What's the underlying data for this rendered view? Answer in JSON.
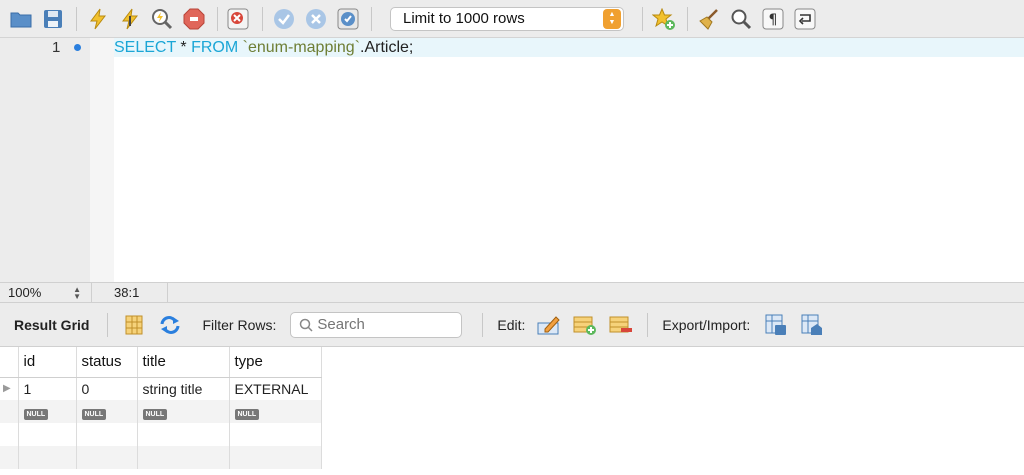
{
  "toolbar": {
    "buttons": [
      {
        "icon": "folder-icon",
        "tooltip": ""
      },
      {
        "icon": "save-icon",
        "tooltip": ""
      },
      {
        "icon": "execute-icon",
        "tooltip": ""
      },
      {
        "icon": "execute-current-icon",
        "tooltip": ""
      },
      {
        "icon": "explain-icon",
        "tooltip": ""
      },
      {
        "icon": "stop-icon",
        "tooltip": ""
      },
      {
        "icon": "toggle-error-icon",
        "tooltip": ""
      },
      {
        "icon": "commit-icon",
        "tooltip": ""
      },
      {
        "icon": "rollback-icon",
        "tooltip": ""
      },
      {
        "icon": "autocommit-icon",
        "tooltip": ""
      },
      {
        "icon": "add-snippet-icon",
        "tooltip": ""
      },
      {
        "icon": "beautify-icon",
        "tooltip": ""
      },
      {
        "icon": "find-icon",
        "tooltip": ""
      },
      {
        "icon": "invisibles-icon",
        "tooltip": ""
      },
      {
        "icon": "wrap-icon",
        "tooltip": ""
      }
    ],
    "limit_label": "Limit to 1000 rows"
  },
  "editor": {
    "line_number": "1",
    "code": {
      "kw1": "SELECT",
      "star": " * ",
      "kw2": "FROM",
      "schema": " `enum-mapping`",
      "table": ".Article;"
    }
  },
  "status": {
    "zoom": "100%",
    "cursor": "38:1"
  },
  "result_bar": {
    "title": "Result Grid",
    "filter_label": "Filter Rows:",
    "search_placeholder": "Search",
    "edit_label": "Edit:",
    "export_label": "Export/Import:"
  },
  "grid": {
    "columns": [
      "id",
      "status",
      "title",
      "type"
    ],
    "rows": [
      [
        "1",
        "0",
        "string title",
        "EXTERNAL"
      ]
    ],
    "null_label": "NULL"
  },
  "colors": {
    "keyword": "#1ba6d6",
    "string": "#6e7e34",
    "accent": "#f0a030"
  }
}
